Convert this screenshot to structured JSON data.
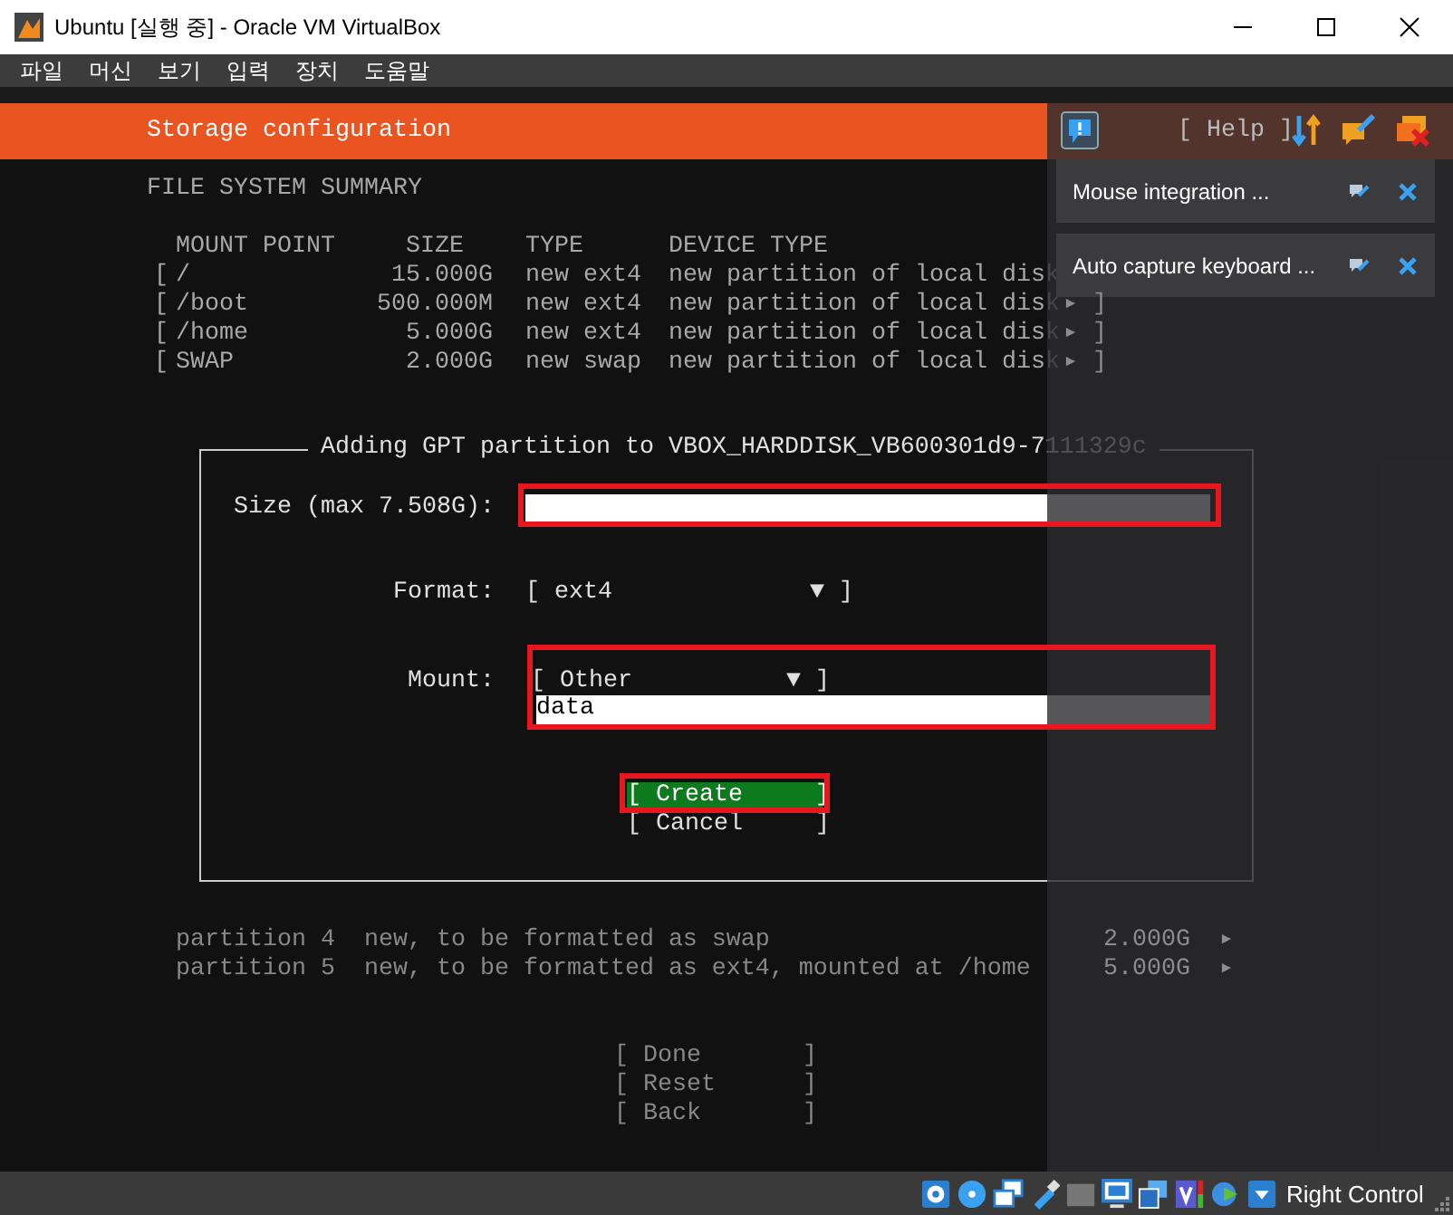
{
  "window": {
    "title": "Ubuntu [실행 중] - Oracle VM VirtualBox"
  },
  "menu": [
    "파일",
    "머신",
    "보기",
    "입력",
    "장치",
    "도움말"
  ],
  "installer": {
    "header": "Storage configuration",
    "help": "[ Help ]",
    "summary_title": "FILE SYSTEM SUMMARY",
    "summary_columns": [
      "MOUNT POINT",
      "SIZE",
      "TYPE",
      "DEVICE TYPE"
    ],
    "summary_rows": [
      {
        "open": "[",
        "mount": "/",
        "size": "15.000G",
        "type": "new ext4",
        "device": "new partition of local disk"
      },
      {
        "open": "[",
        "mount": "/boot",
        "size": "500.000M",
        "type": "new ext4",
        "device": "new partition of local disk",
        "end": "▸ ]"
      },
      {
        "open": "[",
        "mount": "/home",
        "size": "5.000G",
        "type": "new ext4",
        "device": "new partition of local disk",
        "end": "▸ ]"
      },
      {
        "open": "[",
        "mount": "SWAP",
        "size": "2.000G",
        "type": "new swap",
        "device": "new partition of local disk",
        "end": "▸ ]"
      }
    ],
    "partitions": [
      {
        "text": "partition 4  new, to be formatted as swap",
        "size": "2.000G",
        "arrow": "▸"
      },
      {
        "text": "partition 5  new, to be formatted as ext4, mounted at /home",
        "size": "5.000G",
        "arrow": "▸"
      }
    ],
    "actions": [
      "[ Done       ]",
      "[ Reset      ]",
      "[ Back       ]"
    ]
  },
  "dialog": {
    "title": "Adding GPT partition to VBOX_HARDDISK_VB600301d9-7111329c",
    "fields": [
      {
        "kind": "input",
        "label": "Size (max 7.508G):",
        "highlighted": true
      },
      {
        "kind": "select",
        "label": "Format:",
        "value": "[ ext4",
        "arrow": "▼ ]",
        "highlighted": false
      },
      {
        "kind": "select_input",
        "label": "Mount:",
        "value": "[ Other",
        "arrow": "▼ ]",
        "input_value": "data",
        "highlighted": true
      }
    ],
    "buttons": [
      {
        "label": "[ Create     ]",
        "selected": true,
        "highlighted": true
      },
      {
        "label": "[ Cancel     ]",
        "selected": false,
        "highlighted": false
      }
    ]
  },
  "notifications": [
    {
      "text": "Mouse integration ..."
    },
    {
      "text": "Auto capture keyboard ..."
    }
  ],
  "status_bar": {
    "host_key": "Right Control"
  }
}
